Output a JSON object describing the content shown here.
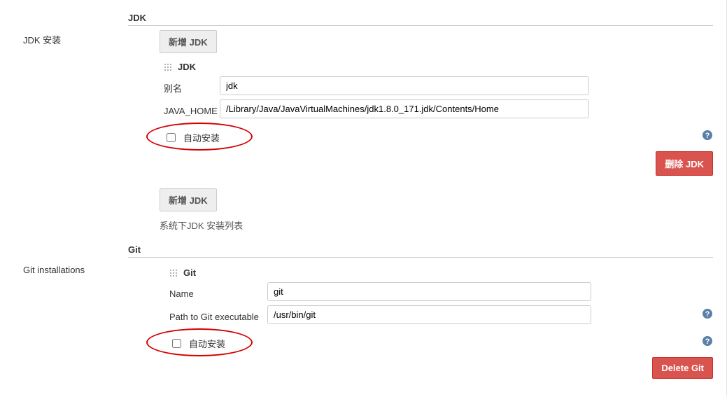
{
  "sections": {
    "jdk": {
      "heading": "JDK",
      "leftLabel": "JDK 安装"
    },
    "git": {
      "heading": "Git",
      "leftLabel": "Git installations"
    }
  },
  "jdk": {
    "addBtnTop": "新增 JDK",
    "blockTitle": "JDK",
    "aliasLabel": "别名",
    "aliasValue": "jdk",
    "javaHomeLabel": "JAVA_HOME",
    "javaHomeValue": "/Library/Java/JavaVirtualMachines/jdk1.8.0_171.jdk/Contents/Home",
    "autoInstall": "自动安装",
    "deleteBtn": "删除 JDK",
    "addBtnBottom": "新增 JDK",
    "listCaption": "系统下JDK 安装列表"
  },
  "git": {
    "blockTitle": "Git",
    "nameLabel": "Name",
    "nameValue": "git",
    "pathLabel": "Path to Git executable",
    "pathValue": "/usr/bin/git",
    "autoInstall": "自动安装",
    "deleteBtn": "Delete Git"
  }
}
